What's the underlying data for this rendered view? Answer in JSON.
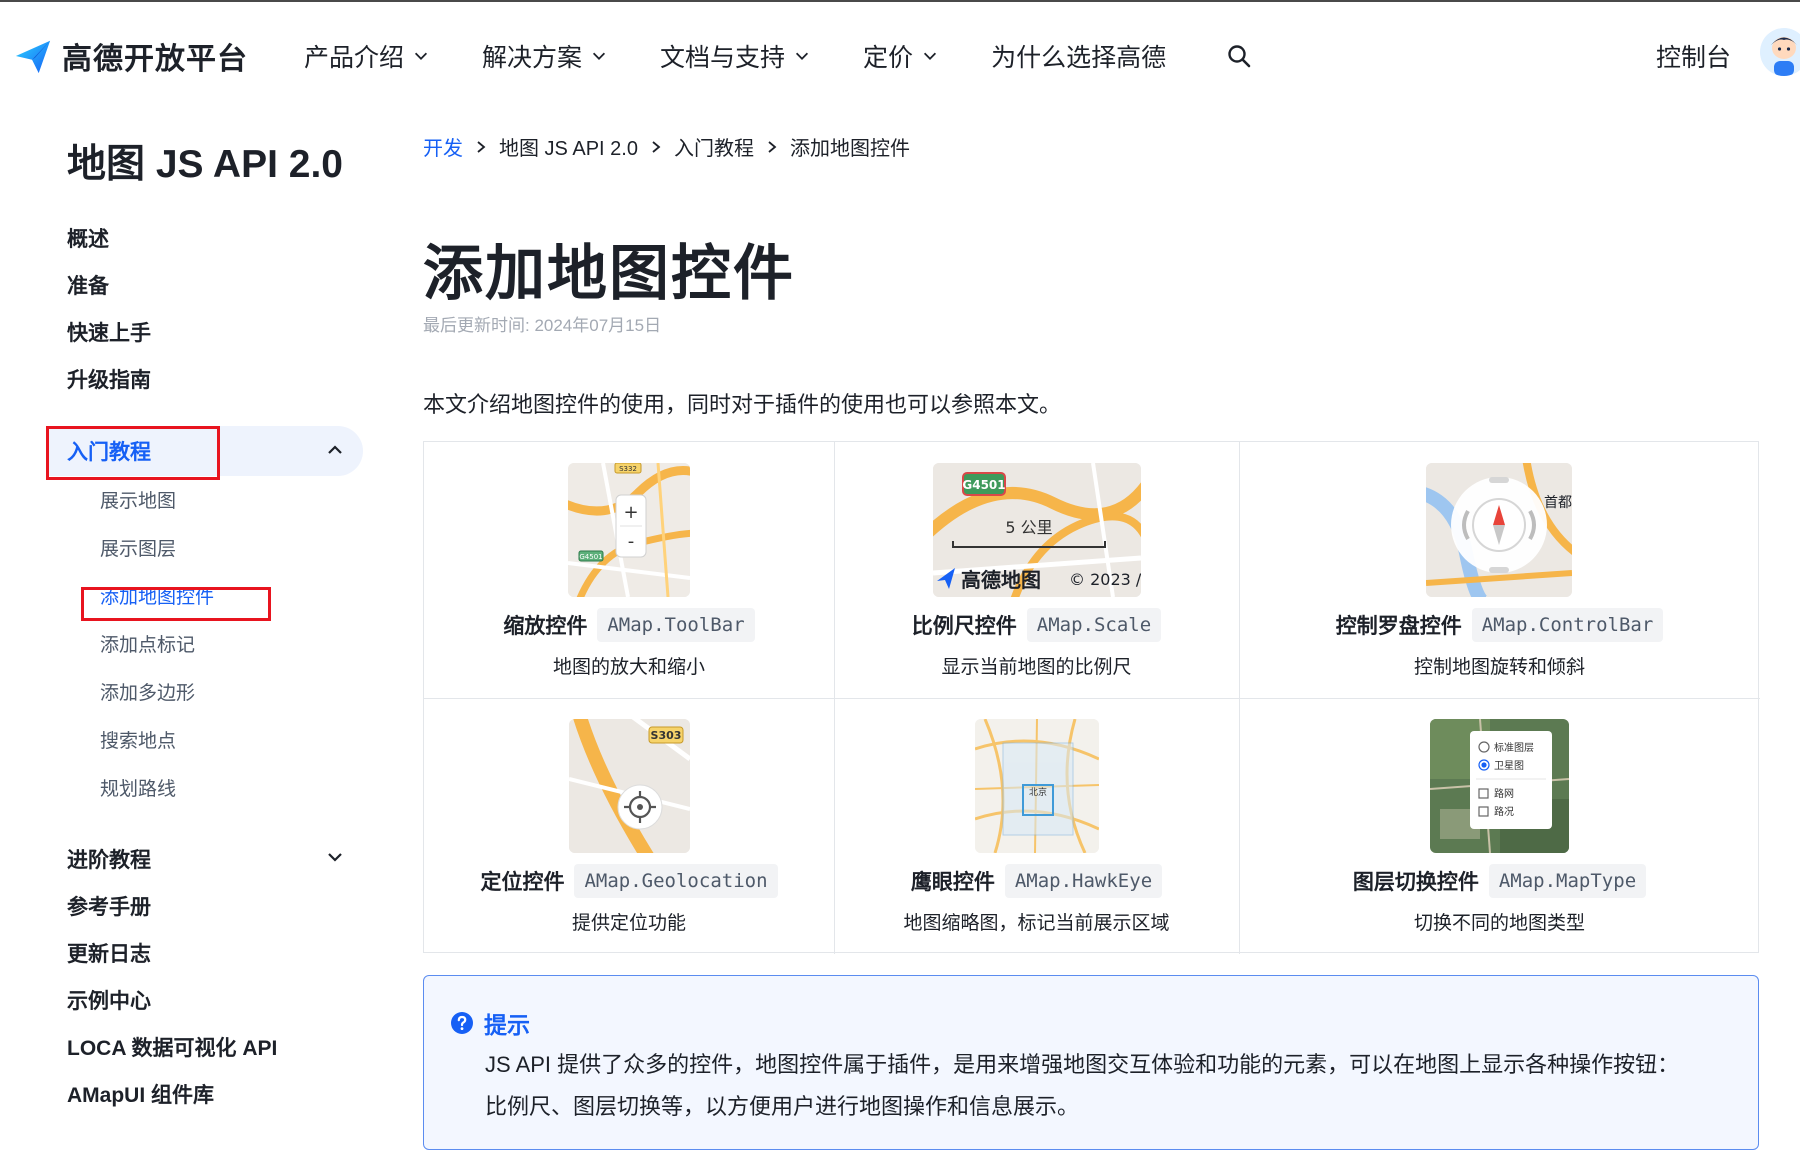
{
  "header": {
    "logo_text": "高德开放平台",
    "nav": [
      {
        "label": "产品介绍",
        "has_dropdown": true
      },
      {
        "label": "解决方案",
        "has_dropdown": true
      },
      {
        "label": "文档与支持",
        "has_dropdown": true
      },
      {
        "label": "定价",
        "has_dropdown": true
      },
      {
        "label": "为什么选择高德",
        "has_dropdown": false
      }
    ],
    "console_label": "控制台"
  },
  "sidebar": {
    "title": "地图 JS API 2.0",
    "items": [
      {
        "label": "概述"
      },
      {
        "label": "准备"
      },
      {
        "label": "快速上手"
      },
      {
        "label": "升级指南"
      },
      {
        "label": "入门教程",
        "expanded": true,
        "active": true
      },
      {
        "label": "进阶教程",
        "expanded": false
      },
      {
        "label": "参考手册"
      },
      {
        "label": "更新日志"
      },
      {
        "label": "示例中心"
      },
      {
        "label": "LOCA 数据可视化 API"
      },
      {
        "label": "AMapUI 组件库"
      }
    ],
    "sub_items": [
      {
        "label": "展示地图"
      },
      {
        "label": "展示图层"
      },
      {
        "label": "添加地图控件",
        "active": true
      },
      {
        "label": "添加点标记"
      },
      {
        "label": "添加多边形"
      },
      {
        "label": "搜索地点"
      },
      {
        "label": "规划路线"
      }
    ]
  },
  "breadcrumb": [
    "开发",
    "地图 JS API 2.0",
    "入门教程",
    "添加地图控件"
  ],
  "page": {
    "title": "添加地图控件",
    "updated": "最后更新时间: 2024年07月15日",
    "intro": "本文介绍地图控件的使用，同时对于插件的使用也可以参照本文。"
  },
  "controls": [
    {
      "name": "缩放控件",
      "code": "AMap.ToolBar",
      "desc": "地图的放大和缩小",
      "icon": "zoom-control"
    },
    {
      "name": "比例尺控件",
      "code": "AMap.Scale",
      "desc": "显示当前地图的比例尺",
      "icon": "scale-control"
    },
    {
      "name": "控制罗盘控件",
      "code": "AMap.ControlBar",
      "desc": "控制地图旋转和倾斜",
      "icon": "compass-control"
    },
    {
      "name": "定位控件",
      "code": "AMap.Geolocation",
      "desc": "提供定位功能",
      "icon": "locate-control"
    },
    {
      "name": "鹰眼控件",
      "code": "AMap.HawkEye",
      "desc": "地图缩略图，标记当前展示区域",
      "icon": "hawkeye-control"
    },
    {
      "name": "图层切换控件",
      "code": "AMap.MapType",
      "desc": "切换不同的地图类型",
      "icon": "maptype-control"
    }
  ],
  "thumb_labels": {
    "zoom_in": "+",
    "zoom_out": "-",
    "zoom_road_1": "S332",
    "zoom_road_2": "G4501",
    "scale_road": "G4501",
    "scale_text": "5 公里",
    "scale_brand": "高德地图",
    "scale_copy": "© 2023 /",
    "compass_city": "首都",
    "locate_road": "S303",
    "hawkeye_city": "北京",
    "maptype_opt1": "标准图层",
    "maptype_opt2": "卫星图",
    "maptype_opt3": "路网",
    "maptype_opt4": "路况"
  },
  "tip": {
    "title": "提示",
    "body": "JS API 提供了众多的控件，地图控件属于插件，是用来增强地图交互体验和功能的元素，可以在地图上显示各种操作按钮：比例尺、图层切换等，以方便用户进行地图操作和信息展示。"
  },
  "colors": {
    "accent": "#1660f5",
    "highlight_box": "#e8141f",
    "tip_border": "#5b8cf0",
    "tip_bg": "#f3f7ff"
  }
}
